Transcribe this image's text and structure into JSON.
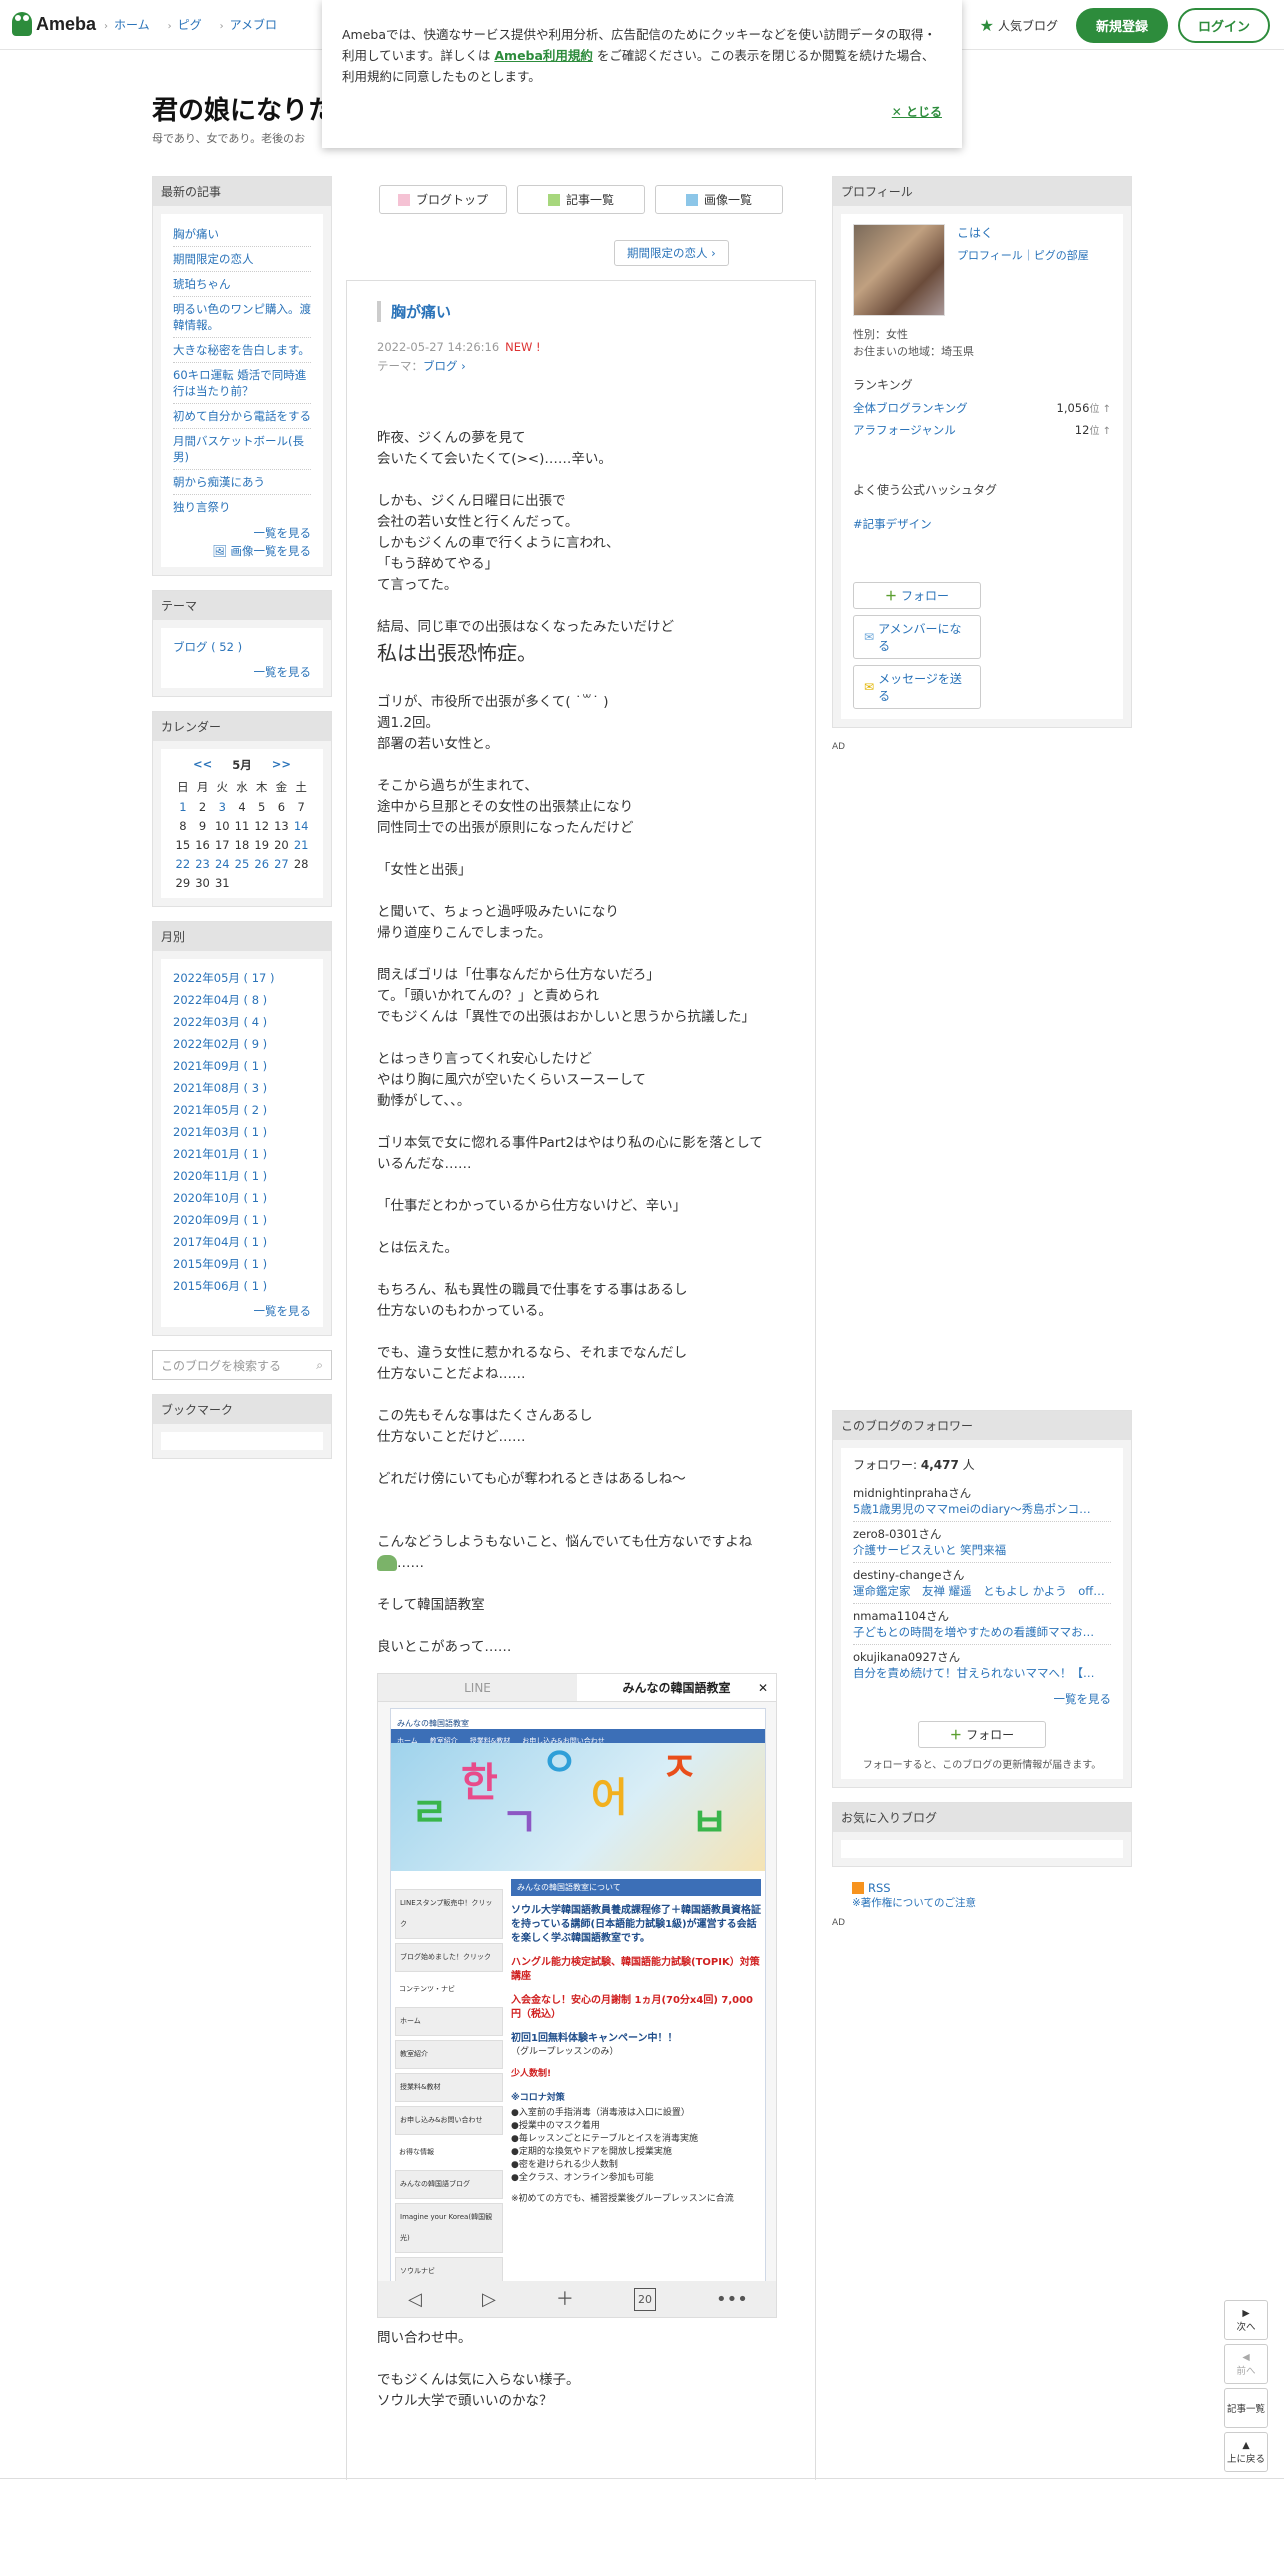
{
  "header": {
    "logo": "Ameba",
    "nav": [
      "ホーム",
      "ピグ",
      "アメブロ"
    ],
    "popular": "人気ブログ",
    "register": "新規登録",
    "login": "ログイン"
  },
  "cookie": {
    "text1": "Amebaでは、快適なサービス提供や利用分析、広告配信のためにクッキーなどを使い訪問データの取得・利用しています。詳しくは",
    "link": "Ameba利用規約",
    "text2": "をご確認ください。この表示を閉じるか閲覧を続けた場合、利用規約に同意したものとします。",
    "close": "とじる"
  },
  "blog": {
    "title": "君の娘になりた",
    "subtitle": "母であり、女であり。老後のお"
  },
  "left": {
    "recent_h": "最新の記事",
    "recent": [
      "胸が痛い",
      "期間限定の恋人",
      "琥珀ちゃん",
      "明るい色のワンピ購入。渡韓情報。",
      "大きな秘密を告白します。",
      "60キロ運転 婚活で同時進行は当たり前？",
      "初めて自分から電話をする",
      "月間バスケットボール(長男)",
      "朝から痴漢にあう",
      "独り言祭り"
    ],
    "more": "一覧を見る",
    "img_more": "画像一覧を見る",
    "theme_h": "テーマ",
    "theme": "ブログ ( 52 )",
    "cal_h": "カレンダー",
    "cal_prev": "<<",
    "cal_month": "5月",
    "cal_next": ">>",
    "weekdays": [
      "日",
      "月",
      "火",
      "水",
      "木",
      "金",
      "土"
    ],
    "month_h": "月別",
    "months": [
      "2022年05月 ( 17 )",
      "2022年04月 ( 8 )",
      "2022年03月 ( 4 )",
      "2022年02月 ( 9 )",
      "2021年09月 ( 1 )",
      "2021年08月 ( 3 )",
      "2021年05月 ( 2 )",
      "2021年03月 ( 1 )",
      "2021年01月 ( 1 )",
      "2020年11月 ( 1 )",
      "2020年10月 ( 1 )",
      "2020年09月 ( 1 )",
      "2017年04月 ( 1 )",
      "2015年09月 ( 1 )",
      "2015年06月 ( 1 )"
    ],
    "search_ph": "このブログを検索する",
    "bookmark_h": "ブックマーク"
  },
  "main": {
    "tabs": [
      "ブログトップ",
      "記事一覧",
      "画像一覧"
    ],
    "prev_post": "期間限定の恋人",
    "title": "胸が痛い",
    "date": "2022-05-27 14:26:16",
    "new": "NEW !",
    "theme_label": "テーマ：",
    "theme": "ブログ",
    "p1": [
      "昨夜、ジくんの夢を見て",
      "会いたくて会いたくて(><)……辛い。"
    ],
    "p2": [
      "しかも、ジくん日曜日に出張で",
      "会社の若い女性と行くんだって。",
      "しかもジくんの車で行くように言われ、",
      "「もう辞めてやる」",
      "て言ってた。"
    ],
    "p3": "結局、同じ車での出張はなくなったみたいだけど",
    "big": "私は出張恐怖症。",
    "p4": [
      "ゴリが、市役所で出張が多くて( ˙꒳​˙ )",
      "週1.2回。",
      "部署の若い女性と。"
    ],
    "p5": [
      "そこから過ちが生まれて、",
      "途中から旦那とその女性の出張禁止になり",
      "同性同士での出張が原則になったんだけど"
    ],
    "p6": "「女性と出張」",
    "p7": [
      "と聞いて、ちょっと過呼吸みたいになり",
      "帰り道座りこんでしまった。"
    ],
    "p8": [
      "問えばゴリは「仕事なんだから仕方ないだろ」",
      "て。「頭いかれてんの？」と責められ",
      "でもジくんは「異性での出張はおかしいと思うから抗議した」"
    ],
    "p9": [
      "とはっきり言ってくれ安心したけど",
      "やはり胸に風穴が空いたくらいスースーして",
      "動悸がして、、。"
    ],
    "p10": [
      "ゴリ本気で女に惚れる事件Part2はやはり私の心に影を落として",
      "いるんだな……"
    ],
    "p11": "「仕事だとわかっているから仕方ないけど、辛い」",
    "p12": "とは伝えた。",
    "p13": [
      "もちろん、私も異性の職員で仕事をする事はあるし",
      "仕方ないのもわかっている。"
    ],
    "p14": [
      "でも、違う女性に惹かれるなら、それまでなんだし",
      "仕方ないことだよね……"
    ],
    "p15": [
      "この先もそんな事はたくさんあるし",
      "仕方ないことだけど……"
    ],
    "p16": "どれだけ傍にいても心が奪われるときはあるしね〜",
    "p17": "こんなどうしようもないこと、悩んでいても仕方ないですよね",
    "p17b": "……",
    "p18": "そして韓国語教室",
    "p19": "良いとこがあって……",
    "p20": "問い合わせ中。",
    "p21": [
      "でもジくんは気に入らない様子。",
      "ソウル大学で頭いいのかな？"
    ],
    "shot": {
      "tab1": "LINE",
      "tab2": "みんなの韓国語教室",
      "close": "✕",
      "site": "みんなの韓国語教室",
      "nav": [
        "ホーム",
        "教室紹介",
        "授業料&教材",
        "お申し込み&お問い合わせ"
      ],
      "side": [
        "LINEスタンプ販売中！クリック",
        "ブログ始めました！クリック",
        "コンテンツ・ナビ",
        "ホーム",
        "教室紹介",
        "授業料&教材",
        "お申し込み&お問い合わせ",
        "お得な情報",
        "みんなの韓国語ブログ",
        "Imagine your Korea(韓国観光)",
        "ソウルナビ"
      ],
      "head": "みんなの韓国語教室について",
      "blue": "ソウル大学韓国語教員養成課程修了＋韓国語教員資格証を持っている講師(日本語能力試験1級)が運営する会話を楽しく学ぶ韓国語教室です。",
      "red1": "ハングル能力検定試験、韓国語能力試験(TOPIK）対策講座",
      "red2": "入会金なし！安心の月謝制 1ヵ月(70分x4回) 7,000円（税込）",
      "camp": "初回1回無料体験キャンペーン中！！",
      "camp2": "（グループレッスンのみ）",
      "few": "少人数制!",
      "corona": "※コロナ対策",
      "list": [
        "●入室前の手指消毒（消毒液は入口に設置）",
        "●授業中のマスク着用",
        "●毎レッスンごとにテーブルとイスを消毒実施",
        "●定期的な換気やドアを開放し授業実施",
        "●密を避けられる少人数制",
        "●全クラス、オンライン参加も可能"
      ],
      "note": "※初めての方でも、補習授業後グループレッスンに合流",
      "bar": [
        "◁",
        "▷",
        "＋",
        "20",
        "•••"
      ]
    }
  },
  "right": {
    "profile_h": "プロフィール",
    "name": "こはく",
    "plinks": "プロフィール｜ピグの部屋",
    "gender": "性別：女性",
    "region": "お住まいの地域：埼玉県",
    "rank_h": "ランキング",
    "ranks": [
      {
        "label": "全体ブログランキング",
        "value": "1,056"
      },
      {
        "label": "アラフォージャンル",
        "value": "12"
      }
    ],
    "rank_unit": "位",
    "hash_h": "よく使う公式ハッシュタグ",
    "hash": "#記事デザイン",
    "follow": "フォロー",
    "member": "アメンバーになる",
    "message": "メッセージを送る",
    "ad": "AD",
    "followers_h": "このブログのフォロワー",
    "followers_label": "フォロワー:",
    "followers_count": "4,477",
    "followers_unit": "人",
    "followers": [
      {
        "n": "midnightinpraha",
        "b": "5歳1歳男児のママmeiのdiary〜秀島ポンコ…"
      },
      {
        "n": "zero8-0301",
        "b": "介護サービスえいと 笑門来福"
      },
      {
        "n": "destiny-change",
        "b": "運命鑑定家　友禅 耀遥　ともよし かよう　off…"
      },
      {
        "n": "nmama1104",
        "b": "子どもとの時間を増やすための看護師ママお…"
      },
      {
        "n": "okujikana0927",
        "b": "自分を責め続けて！甘えられないママへ！【…"
      }
    ],
    "san": "さん",
    "fol_more": "一覧を見る",
    "fol_btn": "フォロー",
    "fol_note": "フォローすると、このブログの更新情報が届きます。",
    "fav_h": "お気に入りブログ",
    "rss": "RSS",
    "copy": "※著作権についてのご注意"
  },
  "float": {
    "next": "次へ",
    "prev": "前へ",
    "list": "記事一覧",
    "top": "上に戻る"
  }
}
